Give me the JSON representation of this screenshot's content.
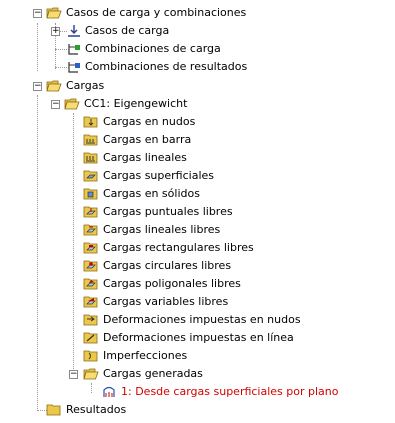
{
  "tree": {
    "casos": {
      "label": "Casos de carga y combinaciones",
      "children": [
        {
          "label": "Casos de carga",
          "icon": "load-case-icon"
        },
        {
          "label": "Combinaciones de carga",
          "icon": "load-combination-icon"
        },
        {
          "label": "Combinaciones de resultados",
          "icon": "result-combination-icon"
        }
      ]
    },
    "cargas": {
      "label": "Cargas",
      "cc1": {
        "label": "CC1: Eigengewicht",
        "children": [
          {
            "label": "Cargas en nudos",
            "icon": "nodal-load-icon"
          },
          {
            "label": "Cargas en barra",
            "icon": "member-load-icon"
          },
          {
            "label": "Cargas lineales",
            "icon": "line-load-icon"
          },
          {
            "label": "Cargas superficiales",
            "icon": "surface-load-icon"
          },
          {
            "label": "Cargas en sólidos",
            "icon": "solid-load-icon"
          },
          {
            "label": "Cargas puntuales libres",
            "icon": "free-point-load-icon"
          },
          {
            "label": "Cargas lineales libres",
            "icon": "free-line-load-icon"
          },
          {
            "label": "Cargas rectangulares libres",
            "icon": "free-rectangular-load-icon"
          },
          {
            "label": "Cargas circulares libres",
            "icon": "free-circular-load-icon"
          },
          {
            "label": "Cargas poligonales libres",
            "icon": "free-polygon-load-icon"
          },
          {
            "label": "Cargas variables libres",
            "icon": "free-variable-load-icon"
          },
          {
            "label": "Deformaciones impuestas en nudos",
            "icon": "imposed-nodal-deformation-icon"
          },
          {
            "label": "Deformaciones impuestas en línea",
            "icon": "imposed-line-deformation-icon"
          },
          {
            "label": "Imperfecciones",
            "icon": "imperfection-icon"
          }
        ],
        "generadas": {
          "label": "Cargas generadas",
          "children": [
            {
              "label": "1: Desde cargas superficiales por plano",
              "icon": "generated-load-icon",
              "color": "#d40000"
            }
          ]
        }
      }
    },
    "resultados": {
      "label": "Resultados"
    }
  }
}
